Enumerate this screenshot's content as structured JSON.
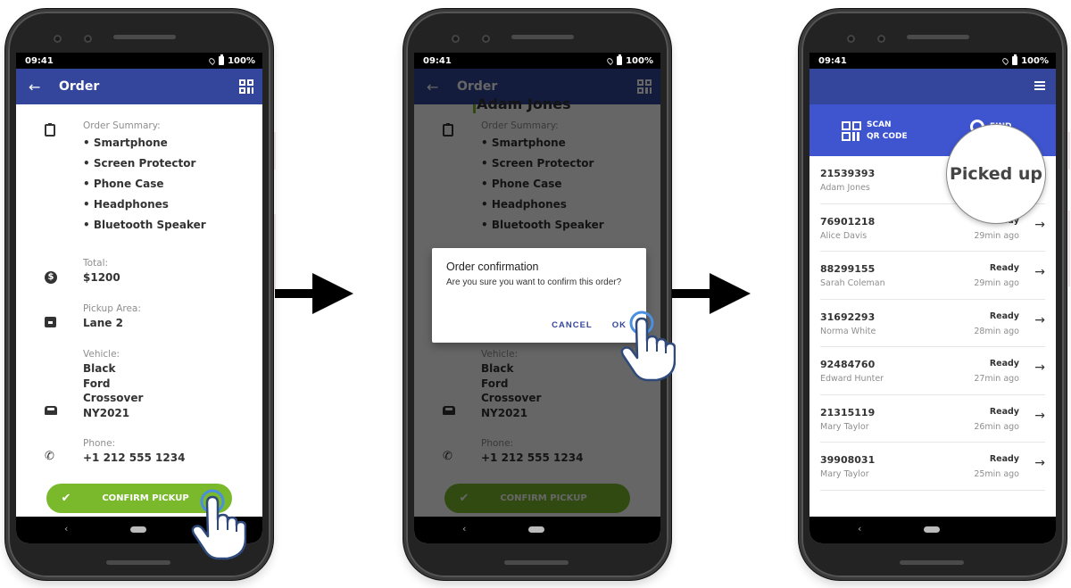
{
  "status_bar": {
    "time": "09:41",
    "battery": "100%"
  },
  "colors": {
    "app_bar": "#34469c",
    "action_bar": "#3f55d0",
    "confirm_green": "#7ab82c",
    "dialog_action": "#34469c"
  },
  "screen1": {
    "app_bar": {
      "title": "Order",
      "back_icon": "arrow-left-icon",
      "qr_icon": "qr-code-icon"
    },
    "order_summary": {
      "label": "Order Summary:",
      "items": [
        "• Smartphone",
        "• Screen Protector",
        "• Phone Case",
        "• Headphones",
        "• Bluetooth Speaker"
      ]
    },
    "total": {
      "label": "Total:",
      "value": "$1200"
    },
    "pickup_area": {
      "label": "Pickup Area:",
      "value": "Lane 2"
    },
    "vehicle": {
      "label": "Vehicle:",
      "lines": [
        "Black",
        "Ford",
        "Crossover",
        "NY2021"
      ]
    },
    "phone": {
      "label": "Phone:",
      "value": "+1 212 555 1234"
    },
    "confirm_button": "CONFIRM PICKUP"
  },
  "screen2": {
    "peek_text": "Adam Jones",
    "dialog": {
      "title": "Order confirmation",
      "message": "Are you sure you want to confirm this order?",
      "cancel": "CANCEL",
      "ok": "OK"
    }
  },
  "screen3": {
    "scan_button": {
      "line1": "SCAN",
      "line2": "QR CODE"
    },
    "find_button": "FIND",
    "magnifier_text": "Picked up",
    "orders": [
      {
        "id": "21539393",
        "name": "Adam Jones",
        "status": "",
        "time": ""
      },
      {
        "id": "76901218",
        "name": "Alice Davis",
        "status": "Ready",
        "time": "29min ago"
      },
      {
        "id": "88299155",
        "name": "Sarah Coleman",
        "status": "Ready",
        "time": "29min ago"
      },
      {
        "id": "31692293",
        "name": "Norma White",
        "status": "Ready",
        "time": "28min ago"
      },
      {
        "id": "92484760",
        "name": "Edward Hunter",
        "status": "Ready",
        "time": "27min ago"
      },
      {
        "id": "21315119",
        "name": "Mary Taylor",
        "status": "Ready",
        "time": "26min ago"
      },
      {
        "id": "39908031",
        "name": "Mary Taylor",
        "status": "Ready",
        "time": "25min ago"
      }
    ]
  }
}
